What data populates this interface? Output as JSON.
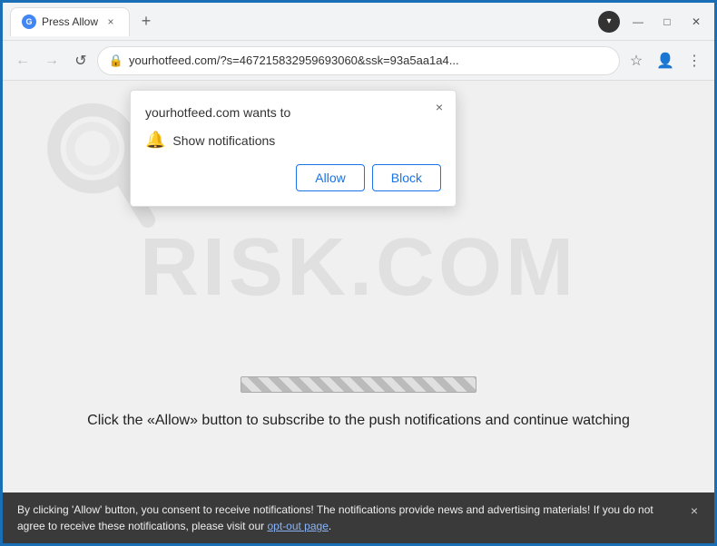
{
  "browser": {
    "title": "Press Allow",
    "tab": {
      "favicon_label": "G",
      "title": "Press Allow",
      "close_label": "×"
    },
    "new_tab_label": "+",
    "window_controls": {
      "minimize": "—",
      "maximize": "□",
      "close": "✕"
    },
    "tab_dropdown": "▾",
    "address_bar": {
      "back_arrow": "←",
      "forward_arrow": "→",
      "reload": "↺",
      "lock_icon": "🔒",
      "url": "yourhotfeed.com/?s=467215832959693060&ssk=93a5aa1a4...",
      "star_icon": "☆",
      "profile_icon": "👤",
      "menu_icon": "⋮"
    }
  },
  "page": {
    "watermark_text": "RISK.COM",
    "progress_bar_label": "progress",
    "click_allow_text": "Click the «Allow» button to subscribe to the push notifications and continue watching"
  },
  "popup": {
    "title": "yourhotfeed.com wants to",
    "close_label": "×",
    "notification_label": "Show notifications",
    "allow_button": "Allow",
    "block_button": "Block"
  },
  "consent_bar": {
    "text": "By clicking 'Allow' button, you consent to receive notifications! The notifications provide news and advertising materials! If you do not agree to receive these notifications, please visit our ",
    "link_text": "opt-out page",
    "link_url": "#",
    "close_label": "×"
  },
  "colors": {
    "border": "#1a6eb5",
    "accent": "#1a73e8",
    "popup_bg": "#ffffff",
    "consent_bg": "#3a3a3a"
  }
}
